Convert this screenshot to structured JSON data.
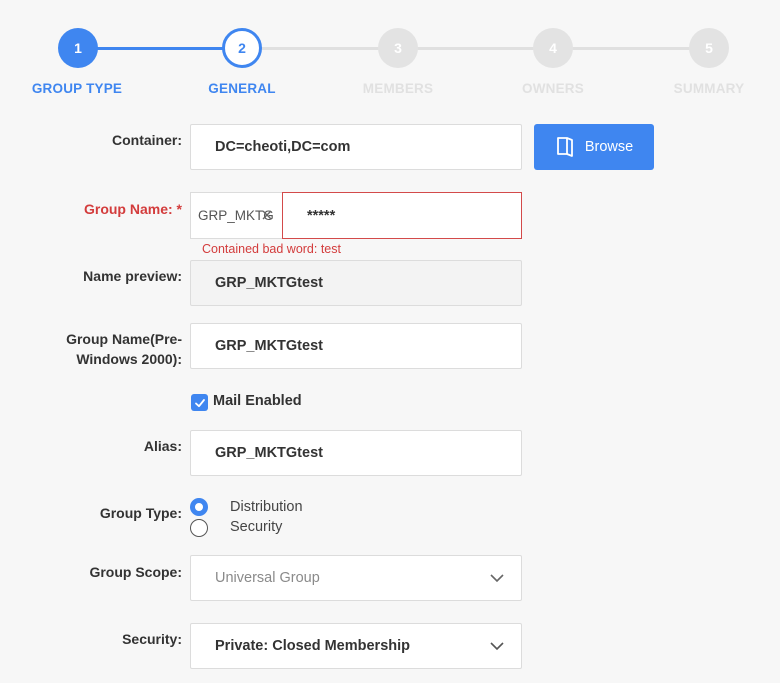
{
  "stepper": {
    "steps": [
      {
        "number": "1",
        "label": "GROUP TYPE",
        "state": "done"
      },
      {
        "number": "2",
        "label": "GENERAL",
        "state": "active"
      },
      {
        "number": "3",
        "label": "MEMBERS",
        "state": "pending"
      },
      {
        "number": "4",
        "label": "OWNERS",
        "state": "pending"
      },
      {
        "number": "5",
        "label": "SUMMARY",
        "state": "pending"
      }
    ]
  },
  "form": {
    "container": {
      "label": "Container:",
      "value": "DC=cheoti,DC=com",
      "browse_label": "Browse"
    },
    "group_name": {
      "label": "Group Name: *",
      "prefix": "GRP_MKTG",
      "value": "*****",
      "error": "Contained bad word: test"
    },
    "name_preview": {
      "label": "Name preview:",
      "value": "GRP_MKTGtest"
    },
    "pre_windows": {
      "label_line1": "Group Name(Pre-",
      "label_line2": "Windows 2000):",
      "value": "GRP_MKTGtest"
    },
    "mail_enabled": {
      "label": "Mail Enabled",
      "checked": true
    },
    "alias": {
      "label": "Alias:",
      "value": "GRP_MKTGtest"
    },
    "group_type": {
      "label": "Group Type:",
      "options": [
        {
          "label": "Distribution",
          "selected": true
        },
        {
          "label": "Security",
          "selected": false
        }
      ]
    },
    "group_scope": {
      "label": "Group Scope:",
      "value": "Universal Group"
    },
    "security": {
      "label": "Security:",
      "value": "Private: Closed Membership"
    }
  },
  "colors": {
    "accent": "#3f86f0",
    "error": "#d33c3c",
    "inactive": "#e3e3e3"
  }
}
